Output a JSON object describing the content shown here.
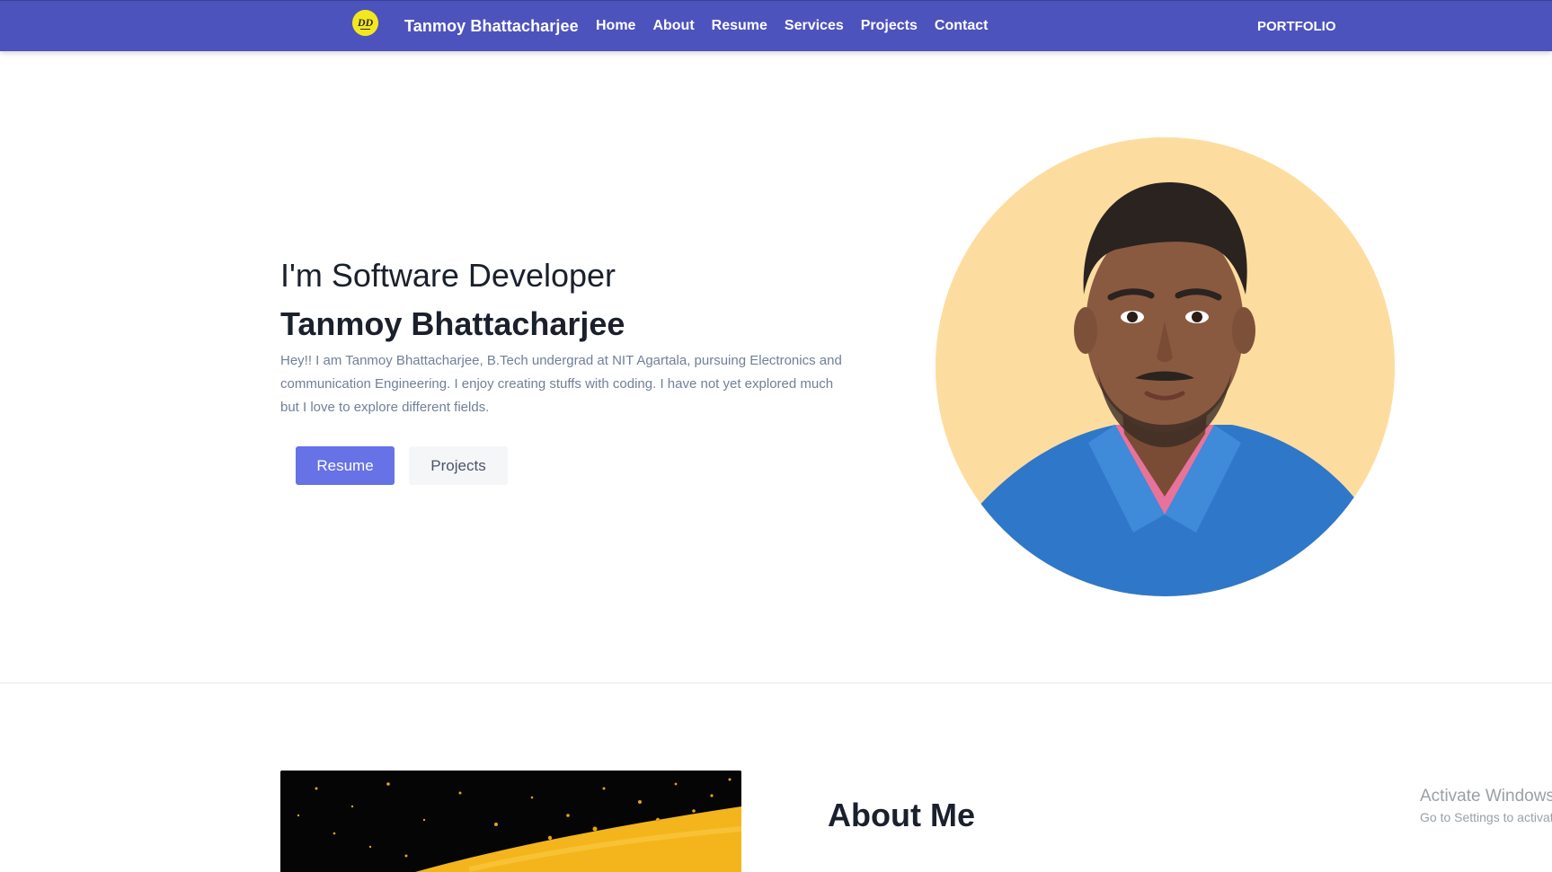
{
  "navbar": {
    "logo_icon": "dd-logo-icon",
    "logo_text": "DD",
    "brand": "Tanmoy Bhattacharjee",
    "links": [
      "Home",
      "About",
      "Resume",
      "Services",
      "Projects",
      "Contact"
    ],
    "right_label": "PORTFOLIO",
    "background_color": "#4d53bd"
  },
  "hero": {
    "subtitle": "I'm Software Developer",
    "name": "Tanmoy Bhattacharjee",
    "description": "Hey!! I am Tanmoy Bhattacharjee, B.Tech undergrad at NIT Agartala, pursuing Electronics and communication Engineering. I enjoy creating stuffs with coding. I have not yet explored much but I love to explore different fields.",
    "primary_button": "Resume",
    "secondary_button": "Projects",
    "primary_color": "#6672e6",
    "avatar_bg_color": "#fddd9f"
  },
  "about": {
    "title": "About Me"
  },
  "watermark": {
    "line1": "Activate Windows",
    "line2": "Go to Settings to activate Windows."
  }
}
